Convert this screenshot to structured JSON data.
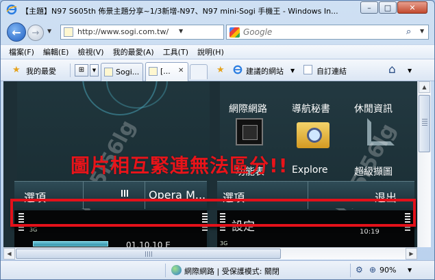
{
  "window": {
    "title": "【主題】N97 S605th 佈景主題分享~1/3新增-N97、N97 mini-Sogi 手機王 - Windows In...",
    "minimize": "–",
    "maximize": "□",
    "close": "✕"
  },
  "nav": {
    "back": "←",
    "forward": "→",
    "url": "http://www.sogi.com.tw/",
    "refresh": "↻",
    "stop": "✕"
  },
  "search": {
    "placeholder": "Google",
    "button": "⌕"
  },
  "menubar": {
    "items": [
      "檔案(F)",
      "編輯(E)",
      "檢視(V)",
      "我的最愛(A)",
      "工具(T)",
      "說明(H)"
    ]
  },
  "favbar": {
    "favorites_label": "我的最愛",
    "quicktabs": "⊞",
    "tabs": [
      {
        "label": "Sogi..."
      },
      {
        "label": "[...",
        "close": "✕"
      }
    ],
    "suggested_sites": "建議的網站",
    "custom_links": "自訂連結",
    "home": "⌂"
  },
  "content": {
    "left_apps": [
      "網際網路",
      "導航秘書",
      "休閒資訊"
    ],
    "right_apps": [
      "功能表",
      "Explore",
      "超級擷圖"
    ],
    "watermark": "hu5l56lg",
    "softkeys_left": [
      "選項",
      "Opera M..."
    ],
    "softkeys_right": [
      "選項",
      "退出"
    ],
    "signal_left": "3G",
    "signal_right": "3G",
    "settings_label": "設定",
    "time": "10:19",
    "date": "01.10.10 E",
    "annotation": "圖片相互緊連無法區分!!"
  },
  "statusbar": {
    "zone": "網際網路 | 受保護模式: 關閉",
    "zoom": "90%"
  },
  "colors": {
    "annotation_red": "#e3111a",
    "screen_bg": "#1d2f36",
    "window_frame": "#b9d1ee"
  }
}
